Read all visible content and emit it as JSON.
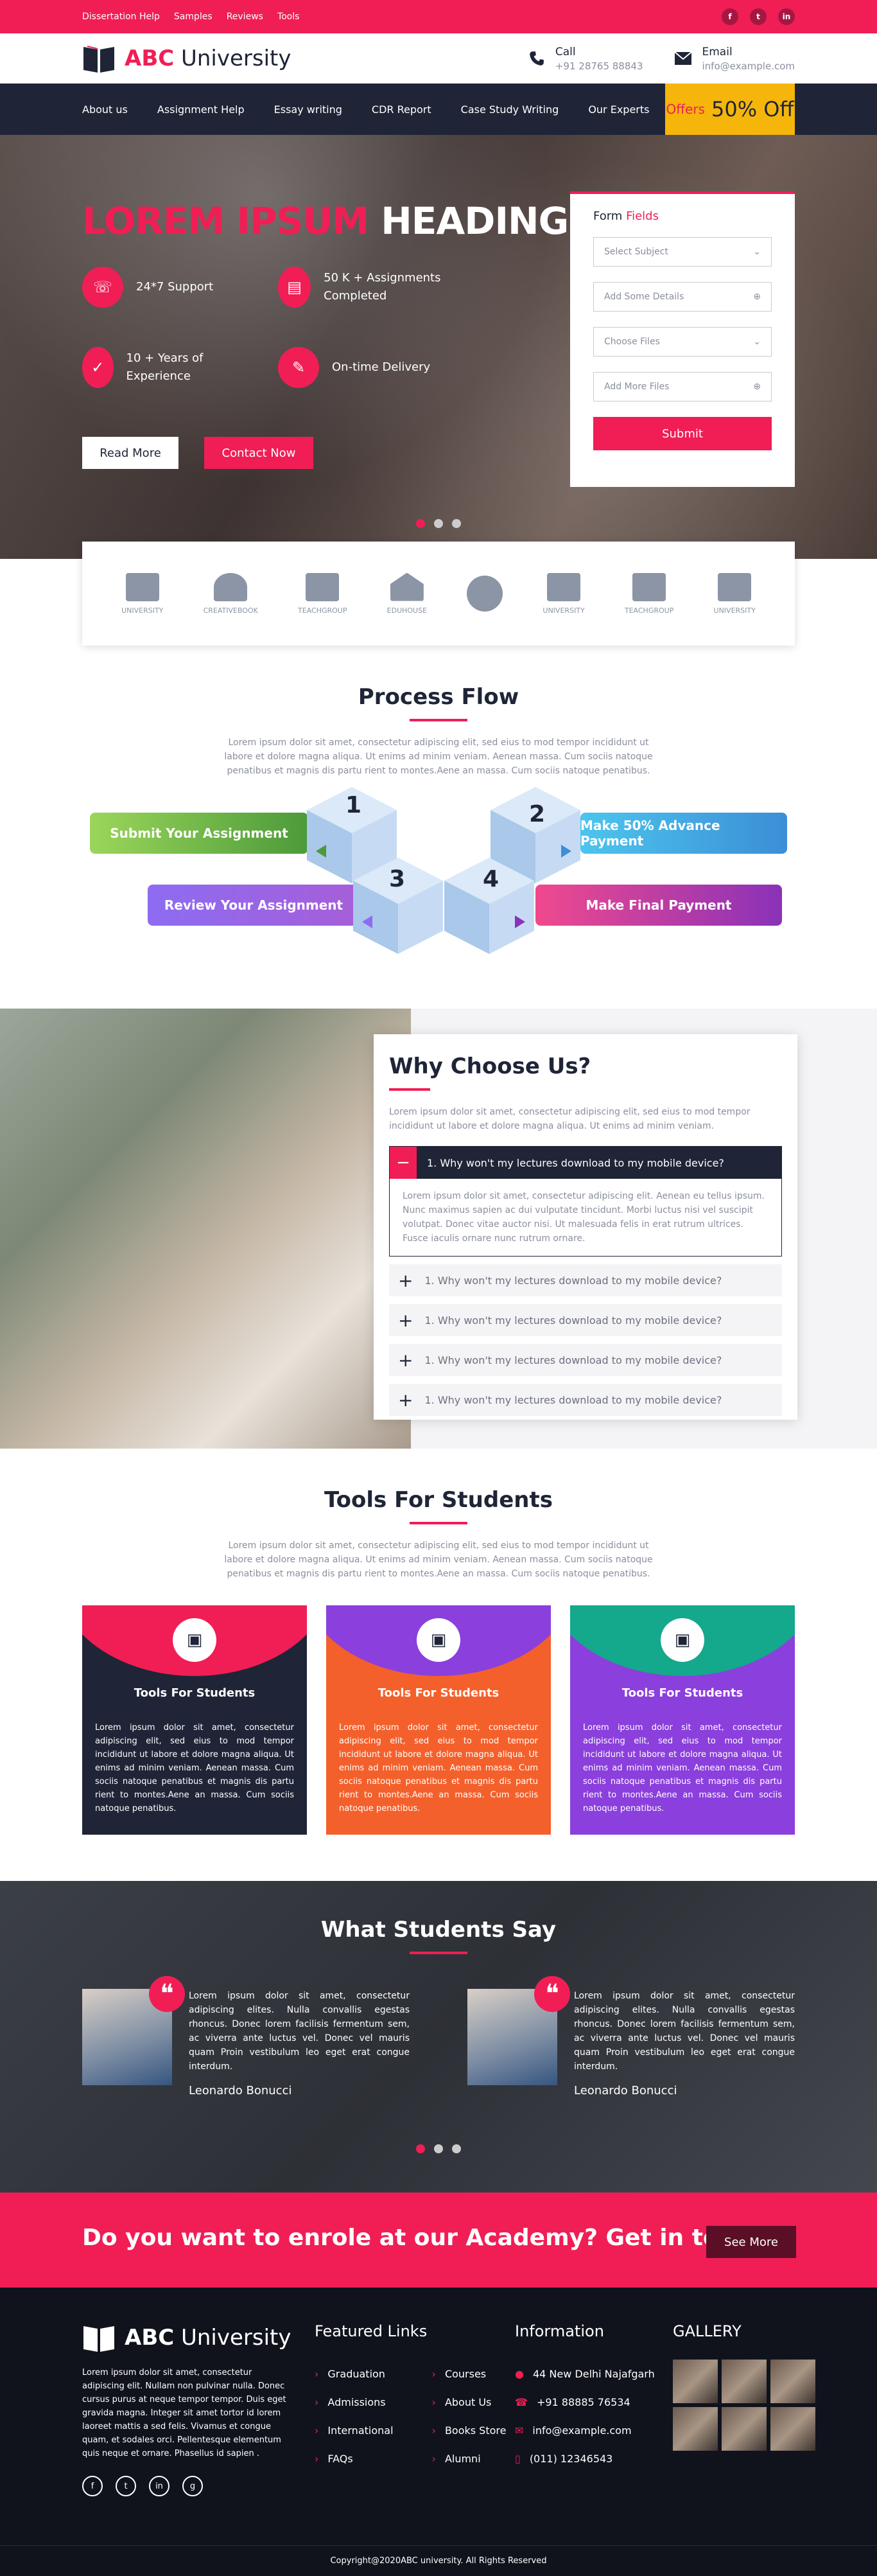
{
  "topbar": {
    "links": [
      "Dissertation Help",
      "Samples",
      "Reviews",
      "Tools"
    ],
    "socials": [
      "f",
      "t",
      "in"
    ]
  },
  "header": {
    "logo_bold": "ABC",
    "logo_rest": " University",
    "call_label": "Call",
    "call_value": "+91 28765 88843",
    "email_label": "Email",
    "email_value": "info@example.com"
  },
  "nav": {
    "items": [
      "About us",
      "Assignment Help",
      "Essay writing",
      "CDR Report",
      "Case Study Writing",
      "Our Experts"
    ],
    "offers_label": "Offers",
    "offers_value": "50% Off"
  },
  "hero": {
    "heading_pink": "LOREM IPSUM",
    "heading_white": " HEADING",
    "features": [
      "24*7 Support",
      "50 K + Assignments Completed",
      "10 + Years of Experience",
      "On-time Delivery"
    ],
    "read_more": "Read More",
    "contact_now": "Contact Now",
    "form": {
      "title_a": "Form",
      "title_b": " Fields",
      "subject": "Select Subject",
      "details": "Add Some Details",
      "files": "Choose Files",
      "more_files": "Add More Files",
      "submit": "Submit"
    }
  },
  "clients": [
    "UNIVERSITY",
    "CREATIVEBOOK",
    "TEACHGROUP",
    "EDUHOUSE",
    "",
    "UNIVERSITY",
    "TEACHGROUP",
    "UNIVERSITY"
  ],
  "process": {
    "title": "Process Flow",
    "text": "Lorem ipsum dolor sit amet, consectetur adipiscing elit, sed eius to mod tempor incididunt ut labore et dolore magna aliqua. Ut enims ad minim veniam. Aenean massa. Cum sociis natoque penatibus et magnis dis partu rient to montes.Aene an massa. Cum sociis natoque penatibus.",
    "steps": [
      "Submit Your Assignment",
      "Make 50% Advance Payment",
      "Review Your Assignment",
      "Make Final Payment"
    ],
    "numbers": [
      "1",
      "2",
      "3",
      "4"
    ]
  },
  "why": {
    "title": "Why Choose Us?",
    "text": "Lorem ipsum dolor sit amet, consectetur adipiscing elit, sed eius to mod tempor incididunt ut labore et dolore magna aliqua. Ut enims ad minim veniam.",
    "open_q": "1. Why won't my lectures download to my mobile device?",
    "open_a": "Lorem ipsum dolor sit amet, consectetur adipiscing elit. Aenean eu tellus ipsum. Nunc maximus sapien ac dui vulputate tincidunt. Morbi luctus nisi vel suscipit volutpat. Donec vitae auctor nisi. Ut malesuada felis in erat rutrum ultrices. Fusce iaculis ornare nunc rutrum ornare.",
    "closed_q": [
      "1. Why won't my lectures download to my mobile device?",
      "1. Why won't my lectures download to my mobile device?",
      "1. Why won't my lectures download to my mobile device?",
      "1. Why won't my lectures download to my mobile device?"
    ]
  },
  "tools": {
    "title": "Tools For Students",
    "text": "Lorem ipsum dolor sit amet, consectetur adipiscing elit, sed eius to mod tempor incididunt ut labore et dolore magna aliqua. Ut enims ad minim veniam. Aenean massa. Cum sociis natoque penatibus et magnis dis partu rient to montes.Aene an massa. Cum sociis natoque penatibus.",
    "cards": [
      {
        "title": "Tools For Students",
        "color": "#f01e55",
        "body": "#1f2537",
        "text": "Lorem ipsum dolor sit amet, consectetur adipiscing elit, sed eius to mod tempor incididunt ut labore et dolore magna aliqua. Ut enims ad minim veniam. Aenean massa. Cum sociis natoque penatibus et magnis dis partu rient to montes.Aene an massa. Cum sociis natoque penatibus."
      },
      {
        "title": "Tools For Students",
        "color": "#8b3fdc",
        "body": "#f4602b",
        "text": "Lorem ipsum dolor sit amet, consectetur adipiscing elit, sed eius to mod tempor incididunt ut labore et dolore magna aliqua. Ut enims ad minim veniam. Aenean massa. Cum sociis natoque penatibus et magnis dis partu rient to montes.Aene an massa. Cum sociis natoque penatibus."
      },
      {
        "title": "Tools For Students",
        "color": "#14a88c",
        "body": "#8b3fdc",
        "text": "Lorem ipsum dolor sit amet, consectetur adipiscing elit, sed eius to mod tempor incididunt ut labore et dolore magna aliqua. Ut enims ad minim veniam. Aenean massa. Cum sociis natoque penatibus et magnis dis partu rient to montes.Aene an massa. Cum sociis natoque penatibus."
      }
    ]
  },
  "testimonials": {
    "title": "What Students Say",
    "items": [
      {
        "text": "Lorem ipsum dolor sit amet, consectetur adipiscing elites. Nulla convallis egestas rhoncus. Donec lorem facilisis fermentum sem, ac viverra ante luctus vel. Donec vel mauris quam Proin vestibulum leo eget erat congue interdum.",
        "name": "Leonardo Bonucci"
      },
      {
        "text": "Lorem ipsum dolor sit amet, consectetur adipiscing elites. Nulla convallis egestas rhoncus. Donec lorem facilisis fermentum sem, ac viverra ante luctus vel. Donec vel mauris quam Proin vestibulum leo eget erat congue interdum.",
        "name": "Leonardo Bonucci"
      }
    ]
  },
  "cta": {
    "text": "Do you want to enrole at our Academy? Get in touch!",
    "button": "See More"
  },
  "footer": {
    "about": "Lorem ipsum dolor sit amet, consectetur adipiscing elit. Nullam non pulvinar nulla. Donec cursus purus at neque tempor tempor. Duis eget gravida magna. Integer sit amet tortor id lorem laoreet mattis a sed felis. Vivamus et congue quam, et sodales orci. Pellentesque elementum quis neque et ornare. Phasellus id sapien .",
    "links_title": "Featured Links",
    "links_a": [
      "Graduation",
      "Admissions",
      "International",
      "FAQs"
    ],
    "links_b": [
      "Courses",
      "About Us",
      "Books Store",
      "Alumni"
    ],
    "info_title": "Information",
    "info": [
      "44 New Delhi Najafgarh",
      "+91 88885 76534",
      "info@example.com",
      "(011) 12346543"
    ],
    "gallery_title": "GALLERY",
    "socials": [
      "f",
      "t",
      "in",
      "g"
    ],
    "copyright": "Copyright@2020ABC university. All Rights Reserved"
  }
}
